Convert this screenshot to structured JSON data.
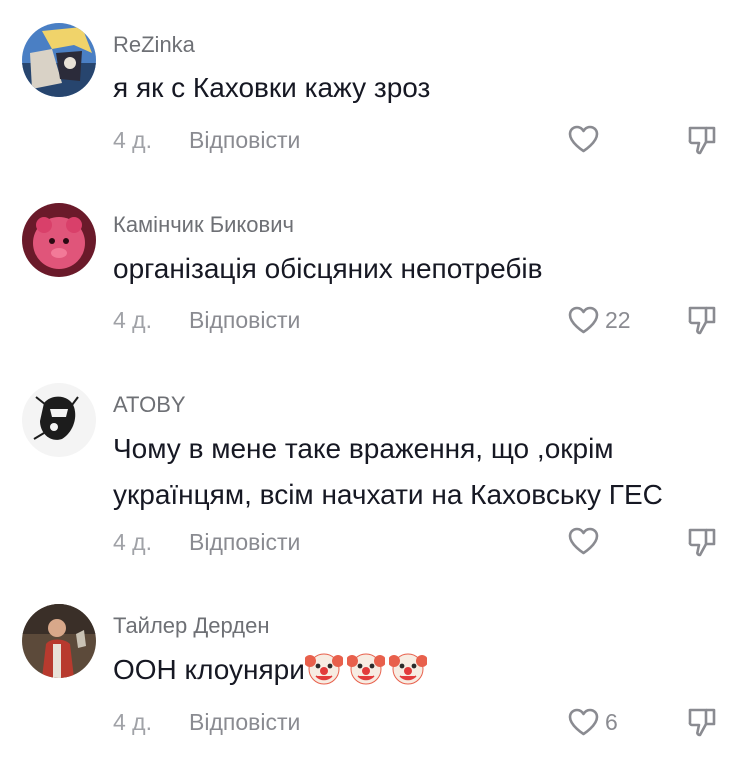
{
  "comments": [
    {
      "username": "ReZinka",
      "text_lines": [
        "я як с Каховки кажу зроз"
      ],
      "time": "4 д.",
      "reply_label": "Відповісти",
      "likes": ""
    },
    {
      "username": "Камінчик Бикович",
      "text_lines": [
        "організація обісцяних непотребів"
      ],
      "time": "4 д.",
      "reply_label": "Відповісти",
      "likes": "22"
    },
    {
      "username": "ATOBY",
      "text_lines": [
        "Чому в мене таке враження, що ,окрім",
        "українцям, всім начхати на Каховську ГЕС"
      ],
      "time": "4 д.",
      "reply_label": "Відповісти",
      "likes": ""
    },
    {
      "username": "Тайлер Дерден",
      "text_lines": [
        "ООН клоуняри"
      ],
      "emoji": [
        "clown-face",
        "clown-face",
        "clown-face"
      ],
      "time": "4 д.",
      "reply_label": "Відповісти",
      "likes": "6"
    }
  ],
  "icons": {
    "like": "heart-outline-icon",
    "dislike": "thumbs-down-outline-icon"
  },
  "colors": {
    "text": "#161823",
    "username": "#6e7075",
    "meta": "#a0a2a7",
    "icon": "#8a8b91"
  }
}
